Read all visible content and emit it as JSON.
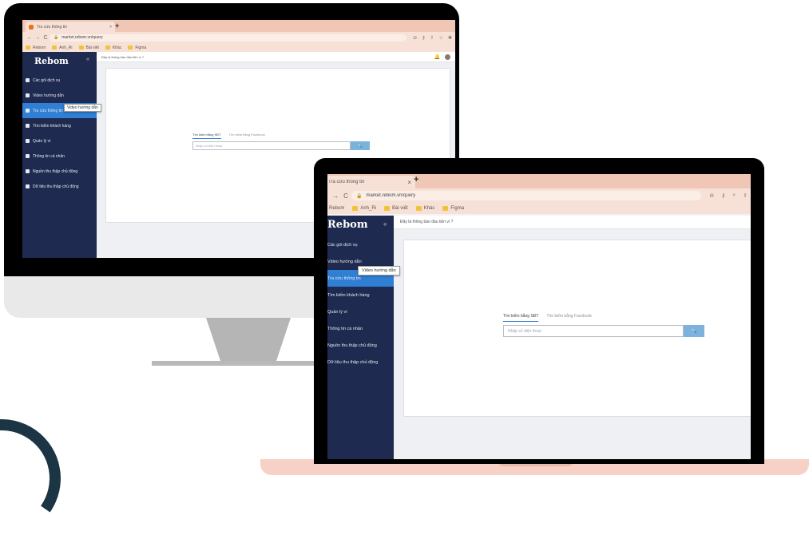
{
  "browser": {
    "tab_title": "Tra cứu thông tin",
    "tab_close": "×",
    "new_tab": "+",
    "url": "market.rebom.vn/query",
    "nav": {
      "back": "←",
      "forward": "→",
      "reload": "C"
    },
    "lock": "🔒",
    "bookmarks": [
      {
        "label": "Rebom"
      },
      {
        "label": "Anh_Ri"
      },
      {
        "label": "Bài viết"
      },
      {
        "label": "Khác"
      },
      {
        "label": "Figma"
      }
    ]
  },
  "app": {
    "logo": "Rebom",
    "collapse": "«",
    "notice": "Đây là thông báo đầu tiên ví ?",
    "bell": "🔔",
    "menu": [
      {
        "label": "Các gói dịch vụ",
        "icon": "grid-icon"
      },
      {
        "label": "Video hướng dẫn",
        "icon": "video-icon"
      },
      {
        "label": "Tra cứu thông tin",
        "icon": "document-icon",
        "active": true
      },
      {
        "label": "Tìm kiếm khách hàng",
        "icon": "users-icon"
      },
      {
        "label": "Quản lý ví",
        "icon": "wallet-icon"
      },
      {
        "label": "Thông tin cá nhân",
        "icon": "user-icon"
      },
      {
        "label": "Nguồn thu thập chủ động",
        "icon": "tag-icon"
      },
      {
        "label": "Dữ liệu thu thập chủ động",
        "icon": "database-icon"
      }
    ],
    "tooltip": "Video hướng dẫn",
    "search_tabs": [
      "Tìm kiếm bằng SĐT",
      "Tìm kiếm bằng Facebook"
    ],
    "search_placeholder": "Nhập số điện thoại",
    "search_button": "🔍"
  },
  "colors": {
    "sidebar": "#1e2a4f",
    "active": "#2f7fd4",
    "browser_chrome": "#f7e1d6",
    "laptop_shell": "#f7d1c6",
    "search_button": "#7ab3de"
  }
}
